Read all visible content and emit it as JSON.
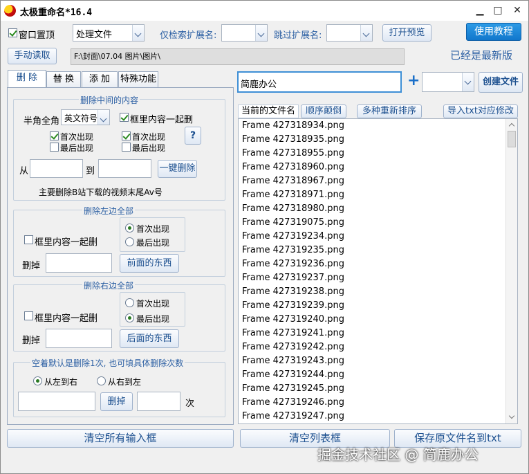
{
  "window": {
    "title": "太极重命名*16.4"
  },
  "titlebar": {
    "minimize": "▁",
    "maximize": "□",
    "close": "✕"
  },
  "toolbar": {
    "topmost_label": "窗口置顶",
    "process_combo_value": "处理文件",
    "only_search_ext_label": "仅检索扩展名:",
    "skip_ext_label": "跳过扩展名:",
    "open_preview": "打开预览",
    "tutorial": "使用教程",
    "manual_read": "手动读取",
    "path": "F:\\封面\\07.04 图片\\图片\\",
    "status": "已经是最新版"
  },
  "tabs": [
    {
      "label": "删 除",
      "active": true
    },
    {
      "label": "替 换",
      "active": false
    },
    {
      "label": "添 加",
      "active": false
    },
    {
      "label": "特殊功能",
      "active": false
    }
  ],
  "delete_middle": {
    "title": "删除中间的内容",
    "halfwidth_label": "半角全角",
    "symbol_combo": "英文符号",
    "frame_together": "框里内容一起删",
    "first_1": "首次出现",
    "last_1": "最后出现",
    "first_2": "首次出现",
    "last_2": "最后出现",
    "help": "?",
    "from": "从",
    "to": "到",
    "one_click": "一键删除",
    "note": "主要删除B站下载的视频末尾Av号"
  },
  "delete_left": {
    "title": "删除左边全部",
    "frame_together": "框里内容一起删",
    "first": "首次出现",
    "last": "最后出现",
    "delete_label": "删掉",
    "button": "前面的东西"
  },
  "delete_right": {
    "title": "删除右边全部",
    "frame_together": "框里内容一起删",
    "first": "首次出现",
    "last": "最后出现",
    "delete_label": "删掉",
    "button": "后面的东西"
  },
  "delete_count": {
    "title": "空着默认是删除1次, 也可填具体删除次数",
    "left_to_right": "从左到右",
    "right_to_left": "从右到左",
    "delete_button": "删掉",
    "times": "次"
  },
  "right_top": {
    "name_input": "简鹿办公",
    "plus": "+",
    "create_file": "创建文件"
  },
  "list_header": {
    "current": "当前的文件名",
    "reverse": "顺序颠倒",
    "multi_sort": "多种重新排序",
    "import_txt": "导入txt对应修改"
  },
  "files": [
    "Frame 427318934.png",
    "Frame 427318935.png",
    "Frame 427318955.png",
    "Frame 427318960.png",
    "Frame 427318967.png",
    "Frame 427318971.png",
    "Frame 427318980.png",
    "Frame 427319075.png",
    "Frame 427319234.png",
    "Frame 427319235.png",
    "Frame 427319236.png",
    "Frame 427319237.png",
    "Frame 427319238.png",
    "Frame 427319239.png",
    "Frame 427319240.png",
    "Frame 427319241.png",
    "Frame 427319242.png",
    "Frame 427319243.png",
    "Frame 427319244.png",
    "Frame 427319245.png",
    "Frame 427319246.png",
    "Frame 427319247.png"
  ],
  "bottom": {
    "clear_inputs": "清空所有输入框",
    "clear_list": "清空列表框",
    "save_names": "保存原文件名到txt"
  },
  "watermark": "掘金技术社区 @ 简鹿办公"
}
